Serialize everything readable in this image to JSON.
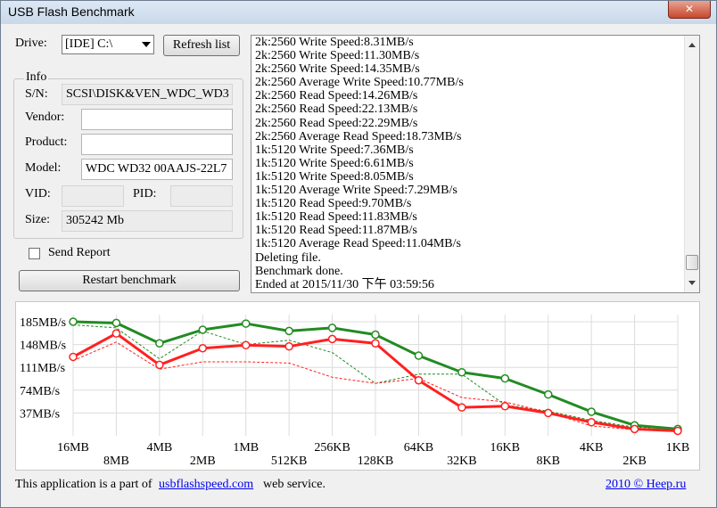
{
  "window": {
    "title": "USB Flash Benchmark",
    "close_glyph": "✕"
  },
  "drive": {
    "label": "Drive:",
    "selected": "[IDE] C:\\"
  },
  "buttons": {
    "refresh": "Refresh list",
    "restart": "Restart benchmark"
  },
  "info": {
    "group_label": "Info",
    "sn_label": "S/N:",
    "sn_value": "SCSI\\DISK&VEN_WDC_WD3",
    "vendor_label": "Vendor:",
    "vendor_value": "",
    "product_label": "Product:",
    "product_value": "",
    "model_label": "Model:",
    "model_value": "WDC WD32 00AAJS-22L7",
    "vid_label": "VID:",
    "vid_value": "",
    "pid_label": "PID:",
    "pid_value": "",
    "size_label": "Size:",
    "size_value": "305242 Mb"
  },
  "send_report": {
    "label": "Send Report",
    "checked": false
  },
  "log": [
    "2k:2560 Write Speed:8.31MB/s",
    "2k:2560 Write Speed:11.30MB/s",
    "2k:2560 Write Speed:14.35MB/s",
    "2k:2560 Average Write Speed:10.77MB/s",
    "2k:2560 Read Speed:14.26MB/s",
    "2k:2560 Read Speed:22.13MB/s",
    "2k:2560 Read Speed:22.29MB/s",
    "2k:2560 Average Read Speed:18.73MB/s",
    "1k:5120 Write Speed:7.36MB/s",
    "1k:5120 Write Speed:6.61MB/s",
    "1k:5120 Write Speed:8.05MB/s",
    "1k:5120 Average Write Speed:7.29MB/s",
    "1k:5120 Read Speed:9.70MB/s",
    "1k:5120 Read Speed:11.83MB/s",
    "1k:5120 Read Speed:11.87MB/s",
    "1k:5120 Average Read Speed:11.04MB/s",
    "Deleting file.",
    "Benchmark done.",
    "Ended at 2015/11/30 下午 03:59:56"
  ],
  "footer": {
    "prefix": "This application is a part of",
    "link": "usbflashspeed.com",
    "suffix": "web service.",
    "credit": "2010 © Heep.ru"
  },
  "colors": {
    "green": "#228B22",
    "red": "#ff2020",
    "grid": "#dcdcdc",
    "accent_close": "#c7472d"
  },
  "chart_data": {
    "type": "line",
    "categories": [
      "16MB",
      "8MB",
      "4MB",
      "2MB",
      "1MB",
      "512KB",
      "256KB",
      "128KB",
      "64KB",
      "32KB",
      "16KB",
      "8KB",
      "4KB",
      "2KB",
      "1KB"
    ],
    "y_ticks": [
      "185MB/s",
      "148MB/s",
      "111MB/s",
      "74MB/s",
      "37MB/s"
    ],
    "ylim": [
      0,
      200
    ],
    "grid": true,
    "series": [
      {
        "style": "solid",
        "color": "#228B22",
        "values": [
          185,
          183,
          150,
          172,
          182,
          170,
          175,
          164,
          130,
          103,
          93,
          67,
          39,
          17,
          11
        ]
      },
      {
        "style": "solid",
        "color": "#ff2020",
        "values": [
          128,
          166,
          115,
          142,
          147,
          145,
          157,
          150,
          90,
          46,
          48,
          37,
          22,
          11,
          8
        ]
      },
      {
        "style": "dashed",
        "color": "#228B22",
        "values": [
          180,
          175,
          125,
          170,
          148,
          155,
          135,
          85,
          100,
          100,
          50,
          40,
          25,
          14,
          11
        ]
      },
      {
        "style": "dashed",
        "color": "#ff2020",
        "values": [
          122,
          152,
          108,
          120,
          120,
          118,
          95,
          85,
          93,
          62,
          55,
          38,
          16,
          10,
          7
        ]
      }
    ]
  }
}
